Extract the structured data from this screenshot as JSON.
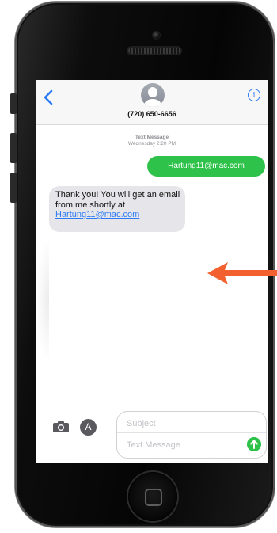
{
  "header": {
    "contact_number": "(720) 650-6656",
    "accent_color": "#2d7cf6",
    "back_icon": "chevron-left-icon",
    "info_icon": "info-icon",
    "info_glyph": "i"
  },
  "conversation": {
    "service": "Text Message",
    "timestamp": "Wednesday 2:20 PM",
    "messages": [
      {
        "direction": "outgoing",
        "text": "Hartung11@mac.com",
        "color": "#2fc24a"
      },
      {
        "direction": "incoming",
        "text_before_link": "Thank you! You will get an email from me shortly at",
        "link": "Hartung11@mac.com",
        "color": "#e6e6ea"
      }
    ]
  },
  "composer": {
    "subject_placeholder": "Subject",
    "message_placeholder": "Text Message",
    "camera_icon": "camera-icon",
    "appstore_icon": "app-store-icon",
    "send_icon": "arrow-up-icon",
    "appstore_glyph": "A"
  },
  "annotation": {
    "arrow_color": "#f2612f",
    "arrow_icon": "arrow-left-icon"
  }
}
